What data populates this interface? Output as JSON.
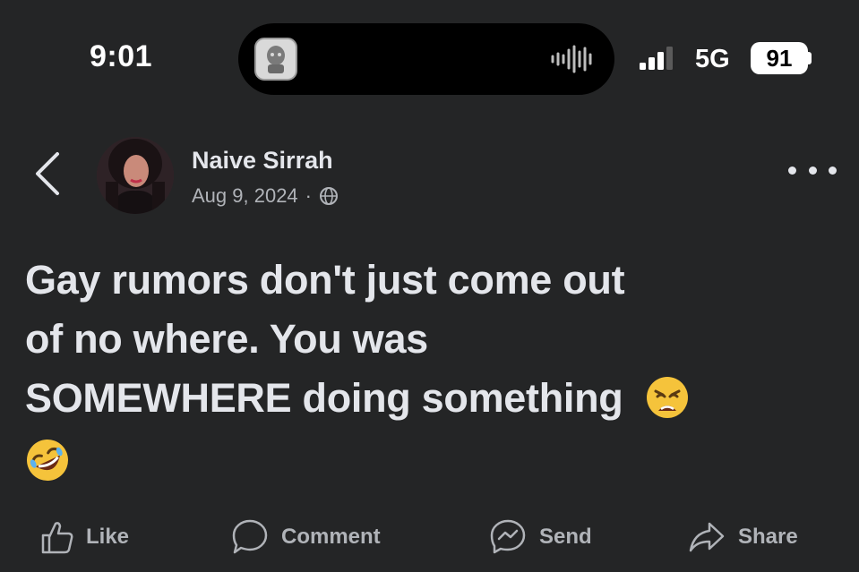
{
  "status_bar": {
    "time": "9:01",
    "network": "5G",
    "battery": "91"
  },
  "post": {
    "author": "Naive Sirrah",
    "date": "Aug 9, 2024",
    "separator": "·",
    "privacy_icon": "globe-icon",
    "lines": [
      "Gay rumors don't just come out",
      "of no where. You was",
      "SOMEWHERE doing something"
    ],
    "emojis": [
      "tired-face-emoji",
      "rolling-laughing-emoji"
    ]
  },
  "actions": {
    "like": "Like",
    "comment": "Comment",
    "send": "Send",
    "share": "Share"
  },
  "colors": {
    "background": "#242526",
    "text": "#e4e6eb",
    "secondary": "#b0b3b8"
  }
}
